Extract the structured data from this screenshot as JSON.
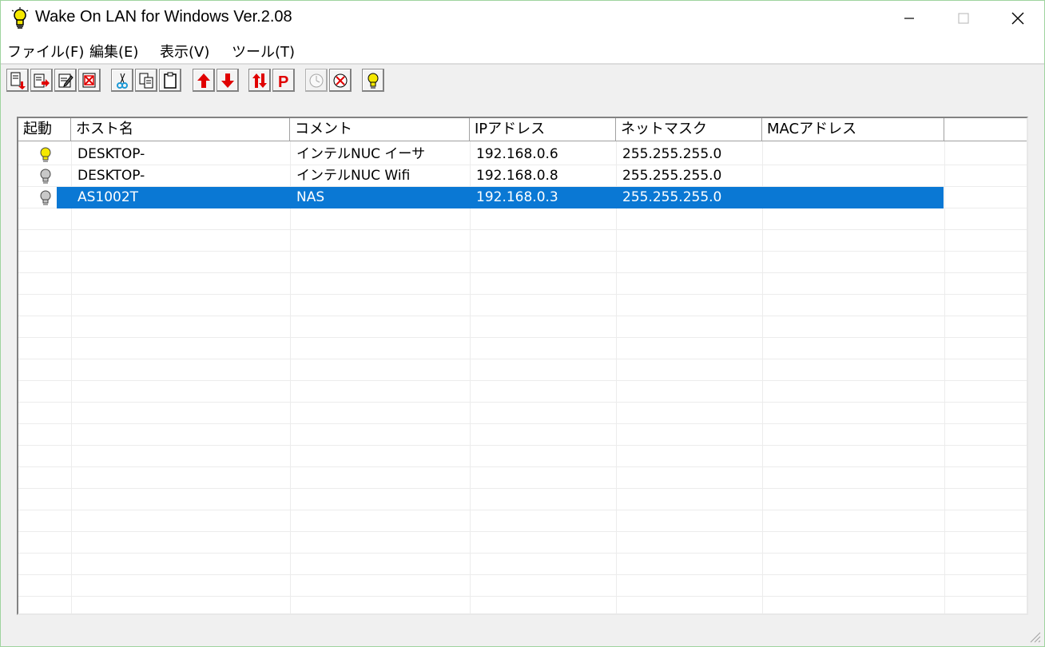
{
  "window": {
    "title": "Wake On LAN for Windows Ver.2.08"
  },
  "menu": [
    {
      "label": "ファイル(F)"
    },
    {
      "label": "編集(E)"
    },
    {
      "label": "表示(V)"
    },
    {
      "label": "ツール(T)"
    }
  ],
  "toolbar": [
    "add-host-icon",
    "import-icon",
    "edit-icon",
    "delete-icon",
    "cut-icon",
    "copy-icon",
    "paste-icon",
    "move-up-icon",
    "move-down-icon",
    "sort-icon",
    "ping-icon",
    "timer-icon",
    "timer-cancel-icon",
    "wake-bulb-icon"
  ],
  "columns": [
    "起動",
    "ホスト名",
    "コメント",
    "IPアドレス",
    "ネットマスク",
    "MACアドレス"
  ],
  "hosts": [
    {
      "status": "on",
      "host": "DESKTOP-",
      "comment": "インテルNUC イーサ",
      "ip": "192.168.0.6",
      "mask": "255.255.255.0",
      "mac": ""
    },
    {
      "status": "off",
      "host": "DESKTOP-",
      "comment": "インテルNUC Wifi",
      "ip": "192.168.0.8",
      "mask": "255.255.255.0",
      "mac": ""
    },
    {
      "status": "off",
      "host": "AS1002T",
      "comment": "NAS",
      "ip": "192.168.0.3",
      "mask": "255.255.255.0",
      "mac": "",
      "selected": true
    }
  ],
  "colors": {
    "selection": "#0a78d4",
    "bulb_on": "#f5e800",
    "bulb_off": "#c8c8c8",
    "toolbar_red": "#e00000"
  }
}
